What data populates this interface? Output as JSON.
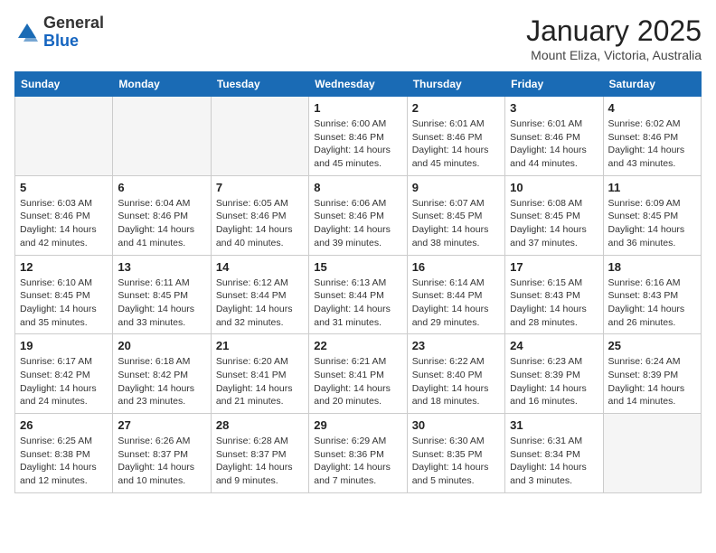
{
  "header": {
    "logo_general": "General",
    "logo_blue": "Blue",
    "title": "January 2025",
    "subtitle": "Mount Eliza, Victoria, Australia"
  },
  "days_of_week": [
    "Sunday",
    "Monday",
    "Tuesday",
    "Wednesday",
    "Thursday",
    "Friday",
    "Saturday"
  ],
  "weeks": [
    [
      {
        "day": "",
        "info": ""
      },
      {
        "day": "",
        "info": ""
      },
      {
        "day": "",
        "info": ""
      },
      {
        "day": "1",
        "info": "Sunrise: 6:00 AM\nSunset: 8:46 PM\nDaylight: 14 hours and 45 minutes."
      },
      {
        "day": "2",
        "info": "Sunrise: 6:01 AM\nSunset: 8:46 PM\nDaylight: 14 hours and 45 minutes."
      },
      {
        "day": "3",
        "info": "Sunrise: 6:01 AM\nSunset: 8:46 PM\nDaylight: 14 hours and 44 minutes."
      },
      {
        "day": "4",
        "info": "Sunrise: 6:02 AM\nSunset: 8:46 PM\nDaylight: 14 hours and 43 minutes."
      }
    ],
    [
      {
        "day": "5",
        "info": "Sunrise: 6:03 AM\nSunset: 8:46 PM\nDaylight: 14 hours and 42 minutes."
      },
      {
        "day": "6",
        "info": "Sunrise: 6:04 AM\nSunset: 8:46 PM\nDaylight: 14 hours and 41 minutes."
      },
      {
        "day": "7",
        "info": "Sunrise: 6:05 AM\nSunset: 8:46 PM\nDaylight: 14 hours and 40 minutes."
      },
      {
        "day": "8",
        "info": "Sunrise: 6:06 AM\nSunset: 8:46 PM\nDaylight: 14 hours and 39 minutes."
      },
      {
        "day": "9",
        "info": "Sunrise: 6:07 AM\nSunset: 8:45 PM\nDaylight: 14 hours and 38 minutes."
      },
      {
        "day": "10",
        "info": "Sunrise: 6:08 AM\nSunset: 8:45 PM\nDaylight: 14 hours and 37 minutes."
      },
      {
        "day": "11",
        "info": "Sunrise: 6:09 AM\nSunset: 8:45 PM\nDaylight: 14 hours and 36 minutes."
      }
    ],
    [
      {
        "day": "12",
        "info": "Sunrise: 6:10 AM\nSunset: 8:45 PM\nDaylight: 14 hours and 35 minutes."
      },
      {
        "day": "13",
        "info": "Sunrise: 6:11 AM\nSunset: 8:45 PM\nDaylight: 14 hours and 33 minutes."
      },
      {
        "day": "14",
        "info": "Sunrise: 6:12 AM\nSunset: 8:44 PM\nDaylight: 14 hours and 32 minutes."
      },
      {
        "day": "15",
        "info": "Sunrise: 6:13 AM\nSunset: 8:44 PM\nDaylight: 14 hours and 31 minutes."
      },
      {
        "day": "16",
        "info": "Sunrise: 6:14 AM\nSunset: 8:44 PM\nDaylight: 14 hours and 29 minutes."
      },
      {
        "day": "17",
        "info": "Sunrise: 6:15 AM\nSunset: 8:43 PM\nDaylight: 14 hours and 28 minutes."
      },
      {
        "day": "18",
        "info": "Sunrise: 6:16 AM\nSunset: 8:43 PM\nDaylight: 14 hours and 26 minutes."
      }
    ],
    [
      {
        "day": "19",
        "info": "Sunrise: 6:17 AM\nSunset: 8:42 PM\nDaylight: 14 hours and 24 minutes."
      },
      {
        "day": "20",
        "info": "Sunrise: 6:18 AM\nSunset: 8:42 PM\nDaylight: 14 hours and 23 minutes."
      },
      {
        "day": "21",
        "info": "Sunrise: 6:20 AM\nSunset: 8:41 PM\nDaylight: 14 hours and 21 minutes."
      },
      {
        "day": "22",
        "info": "Sunrise: 6:21 AM\nSunset: 8:41 PM\nDaylight: 14 hours and 20 minutes."
      },
      {
        "day": "23",
        "info": "Sunrise: 6:22 AM\nSunset: 8:40 PM\nDaylight: 14 hours and 18 minutes."
      },
      {
        "day": "24",
        "info": "Sunrise: 6:23 AM\nSunset: 8:39 PM\nDaylight: 14 hours and 16 minutes."
      },
      {
        "day": "25",
        "info": "Sunrise: 6:24 AM\nSunset: 8:39 PM\nDaylight: 14 hours and 14 minutes."
      }
    ],
    [
      {
        "day": "26",
        "info": "Sunrise: 6:25 AM\nSunset: 8:38 PM\nDaylight: 14 hours and 12 minutes."
      },
      {
        "day": "27",
        "info": "Sunrise: 6:26 AM\nSunset: 8:37 PM\nDaylight: 14 hours and 10 minutes."
      },
      {
        "day": "28",
        "info": "Sunrise: 6:28 AM\nSunset: 8:37 PM\nDaylight: 14 hours and 9 minutes."
      },
      {
        "day": "29",
        "info": "Sunrise: 6:29 AM\nSunset: 8:36 PM\nDaylight: 14 hours and 7 minutes."
      },
      {
        "day": "30",
        "info": "Sunrise: 6:30 AM\nSunset: 8:35 PM\nDaylight: 14 hours and 5 minutes."
      },
      {
        "day": "31",
        "info": "Sunrise: 6:31 AM\nSunset: 8:34 PM\nDaylight: 14 hours and 3 minutes."
      },
      {
        "day": "",
        "info": ""
      }
    ]
  ]
}
